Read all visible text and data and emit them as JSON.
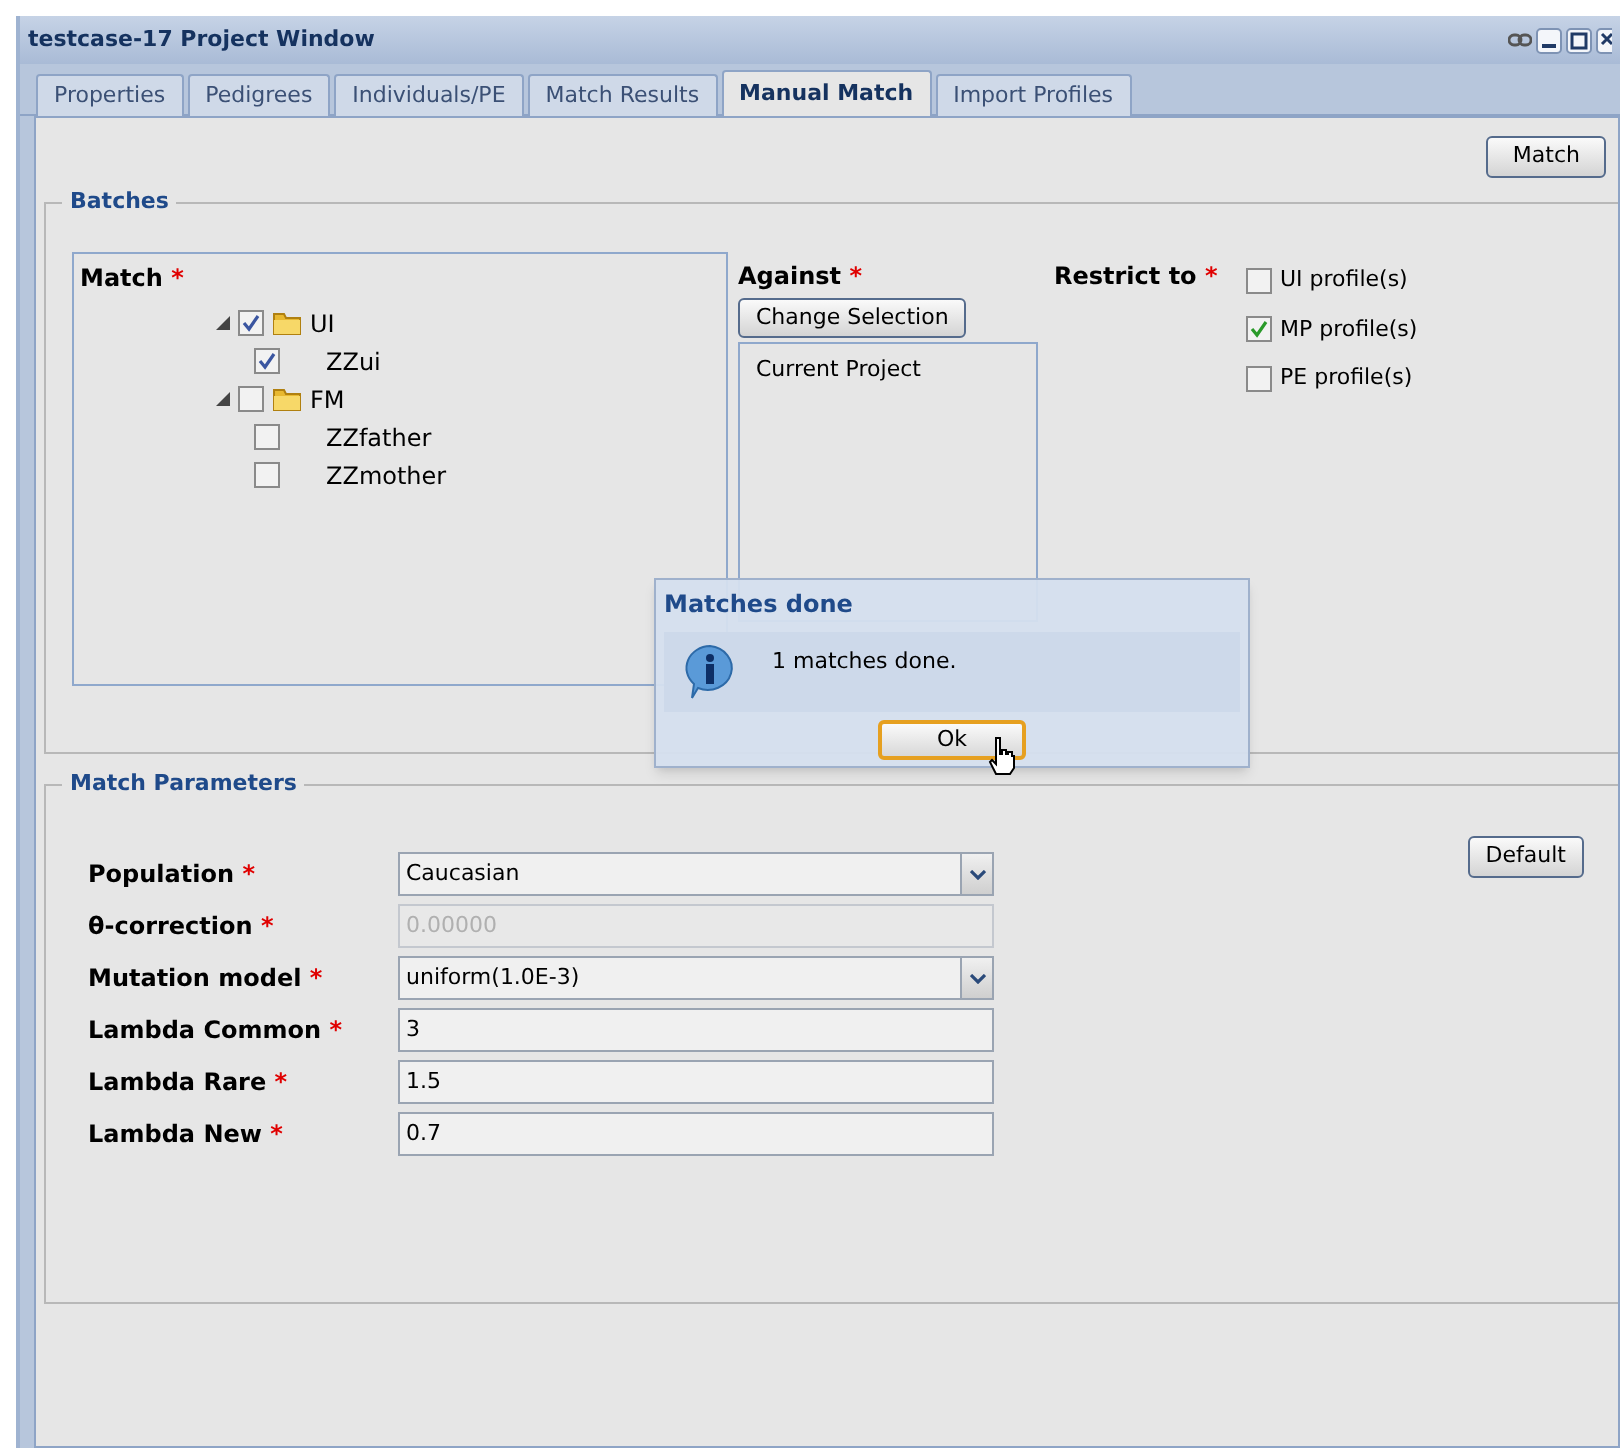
{
  "window": {
    "title": "testcase-17 Project Window"
  },
  "tabs": [
    {
      "label": "Properties",
      "selected": false
    },
    {
      "label": "Pedigrees",
      "selected": false
    },
    {
      "label": "Individuals/PE",
      "selected": false
    },
    {
      "label": "Match Results",
      "selected": false
    },
    {
      "label": "Manual Match",
      "selected": true
    },
    {
      "label": "Import Profiles",
      "selected": false
    }
  ],
  "match_button": "Match",
  "batches": {
    "legend": "Batches",
    "match": {
      "label": "Match",
      "mark": "*",
      "tree": [
        {
          "label": "UI",
          "checked": true,
          "expanded": true,
          "children": [
            {
              "label": "ZZui",
              "checked": true
            }
          ]
        },
        {
          "label": "FM",
          "checked": false,
          "expanded": true,
          "children": [
            {
              "label": "ZZfather",
              "checked": false
            },
            {
              "label": "ZZmother",
              "checked": false
            }
          ]
        }
      ]
    },
    "against": {
      "label": "Against",
      "mark": "*",
      "button": "Change Selection",
      "items": [
        "Current Project"
      ]
    },
    "restrict": {
      "label": "Restrict to",
      "mark": "*",
      "options": [
        {
          "label": "UI profile(s)",
          "checked": false
        },
        {
          "label": "MP profile(s)",
          "checked": true
        },
        {
          "label": "PE profile(s)",
          "checked": false
        }
      ]
    }
  },
  "params": {
    "legend": "Match Parameters",
    "default_button": "Default",
    "fields": [
      {
        "label": "Population",
        "mark": "*",
        "kind": "dropdown",
        "value": "Caucasian",
        "disabled": false
      },
      {
        "label": "θ-correction",
        "mark": "*",
        "kind": "text",
        "value": "0.00000",
        "disabled": true
      },
      {
        "label": "Mutation model",
        "mark": "*",
        "kind": "dropdown",
        "value": "uniform(1.0E-3)",
        "disabled": false
      },
      {
        "label": "Lambda Common",
        "mark": "*",
        "kind": "text",
        "value": "3",
        "disabled": false
      },
      {
        "label": "Lambda Rare",
        "mark": "*",
        "kind": "text",
        "value": "1.5",
        "disabled": false
      },
      {
        "label": "Lambda New",
        "mark": "*",
        "kind": "text",
        "value": "0.7",
        "disabled": false
      }
    ]
  },
  "dialog": {
    "title": "Matches done",
    "message": "1 matches done.",
    "button": "Ok"
  }
}
